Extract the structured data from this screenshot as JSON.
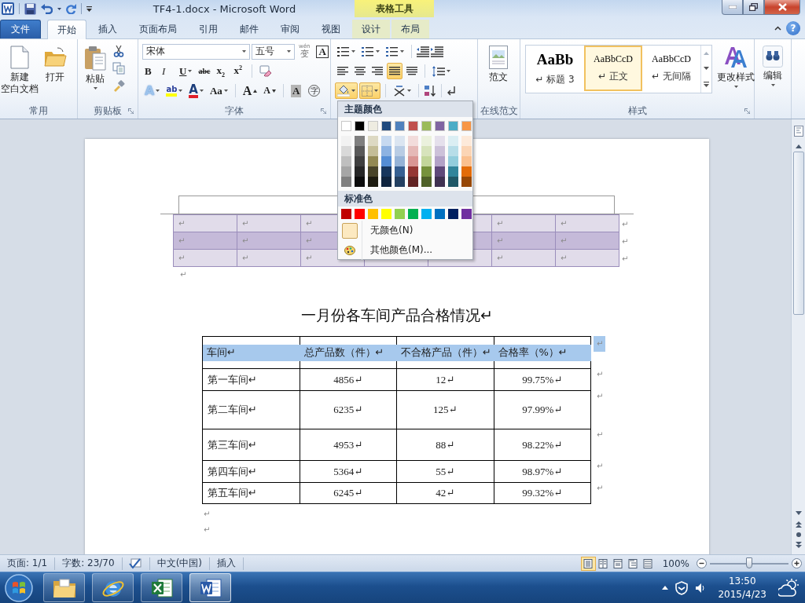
{
  "window": {
    "title": "TF4-1.docx  -  Microsoft Word",
    "context_group": "表格工具"
  },
  "tabs": [
    {
      "label": "文件",
      "kind": "file",
      "selected": false
    },
    {
      "label": "开始",
      "kind": "tab",
      "selected": true
    },
    {
      "label": "插入",
      "kind": "tab",
      "selected": false
    },
    {
      "label": "页面布局",
      "kind": "tab",
      "selected": false
    },
    {
      "label": "引用",
      "kind": "tab",
      "selected": false
    },
    {
      "label": "邮件",
      "kind": "tab",
      "selected": false
    },
    {
      "label": "审阅",
      "kind": "tab",
      "selected": false
    },
    {
      "label": "视图",
      "kind": "tab",
      "selected": false
    },
    {
      "label": "设计",
      "kind": "context",
      "selected": false
    },
    {
      "label": "布局",
      "kind": "context",
      "selected": false
    }
  ],
  "help": "?",
  "ribbon": {
    "common": {
      "label": "常用",
      "new_lines": [
        "新建",
        "空白文档"
      ],
      "open": "打开"
    },
    "clipboard": {
      "label": "剪贴板",
      "paste": "粘贴"
    },
    "font": {
      "label": "字体",
      "font_name": "宋体",
      "font_size": "五号",
      "phonetic": [
        "wén",
        "变"
      ],
      "char_border": "A",
      "row2": [
        [
          {
            "kind": "bold",
            "label": "B",
            "menu": false
          },
          {
            "kind": "italic",
            "label": "I",
            "menu": false
          },
          {
            "kind": "underline",
            "label": "U",
            "menu": true
          },
          {
            "kind": "strike",
            "label": "abc",
            "menu": false
          },
          {
            "kind": "script",
            "label": "x$_{2}$",
            "menu": false
          },
          {
            "kind": "script",
            "label": "x$^{2}$",
            "menu": false
          }
        ],
        [
          {
            "kind": "clear",
            "menu": false
          }
        ]
      ],
      "row3": [
        [
          {
            "kind": "effect",
            "label": "A",
            "menu": true
          },
          {
            "kind": "highlight",
            "label": "ab",
            "menu": true
          },
          {
            "kind": "color",
            "label": "A",
            "menu": true
          },
          {
            "kind": "case",
            "label": "Aa",
            "menu": true
          }
        ],
        [
          {
            "kind": "grow",
            "label": "A",
            "menu": false
          },
          {
            "kind": "shrink",
            "label": "A",
            "menu": false
          }
        ],
        [
          {
            "kind": "shade",
            "label": "A",
            "menu": false
          },
          {
            "kind": "enclose",
            "label": "字",
            "menu": false
          }
        ]
      ]
    },
    "paragraph": {
      "alignments": [
        {
          "kind": "left",
          "selected": false
        },
        {
          "kind": "center",
          "selected": false
        },
        {
          "kind": "right",
          "selected": false
        },
        {
          "kind": "justify",
          "selected": true
        },
        {
          "kind": "distribute",
          "selected": false
        }
      ],
      "shading_pressed": true,
      "borders_pressed": true
    },
    "online": {
      "label": "在线范文",
      "button": "范文"
    },
    "styles": {
      "label": "样式",
      "items": [
        {
          "preview": "AaBb",
          "name": "↵ 标题 3",
          "kind": "heading",
          "selected": false
        },
        {
          "preview": "AaBbCcD",
          "name": "↵ 正文",
          "kind": "normal",
          "selected": true
        },
        {
          "preview": "AaBbCcD",
          "name": "↵ 无间隔",
          "kind": "normal",
          "selected": false
        }
      ],
      "change": "更改样式"
    },
    "editing": {
      "button": "编辑"
    }
  },
  "color_menu": {
    "theme_title": "主题颜色",
    "theme_colors": [
      {
        "color": "#ffffff",
        "shades": [
          {
            "color": "#f2f2f2"
          },
          {
            "color": "#d9d9d9"
          },
          {
            "color": "#bfbfbf"
          },
          {
            "color": "#a6a6a6"
          },
          {
            "color": "#808080"
          }
        ]
      },
      {
        "color": "#000000",
        "shades": [
          {
            "color": "#7f7f7f"
          },
          {
            "color": "#595959"
          },
          {
            "color": "#3f3f3f"
          },
          {
            "color": "#262626"
          },
          {
            "color": "#0c0c0c"
          }
        ]
      },
      {
        "color": "#eeece1",
        "shades": [
          {
            "color": "#ddd9c3"
          },
          {
            "color": "#c4bd97"
          },
          {
            "color": "#938953"
          },
          {
            "color": "#494429"
          },
          {
            "color": "#1d1b10"
          }
        ]
      },
      {
        "color": "#1f497d",
        "shades": [
          {
            "color": "#c6d9f0"
          },
          {
            "color": "#8db3e2"
          },
          {
            "color": "#548dd4"
          },
          {
            "color": "#17365d"
          },
          {
            "color": "#0f243e"
          }
        ]
      },
      {
        "color": "#4f81bd",
        "shades": [
          {
            "color": "#dbe5f1"
          },
          {
            "color": "#b8cce4"
          },
          {
            "color": "#95b3d7"
          },
          {
            "color": "#366092"
          },
          {
            "color": "#244061"
          }
        ]
      },
      {
        "color": "#c0504d",
        "shades": [
          {
            "color": "#f2dcdb"
          },
          {
            "color": "#e5b9b7"
          },
          {
            "color": "#d99694"
          },
          {
            "color": "#953734"
          },
          {
            "color": "#632423"
          }
        ]
      },
      {
        "color": "#9bbb59",
        "shades": [
          {
            "color": "#ebf1dd"
          },
          {
            "color": "#d7e3bc"
          },
          {
            "color": "#c3d69b"
          },
          {
            "color": "#76923c"
          },
          {
            "color": "#4f6128"
          }
        ]
      },
      {
        "color": "#8064a2",
        "shades": [
          {
            "color": "#e5e0ec"
          },
          {
            "color": "#ccc1d9"
          },
          {
            "color": "#b2a2c7"
          },
          {
            "color": "#5f497a"
          },
          {
            "color": "#3f3151"
          }
        ]
      },
      {
        "color": "#4bacc6",
        "shades": [
          {
            "color": "#dbeef3"
          },
          {
            "color": "#b7dde8"
          },
          {
            "color": "#92cddc"
          },
          {
            "color": "#31859b"
          },
          {
            "color": "#205867"
          }
        ]
      },
      {
        "color": "#f79646",
        "shades": [
          {
            "color": "#fdeada"
          },
          {
            "color": "#fbd5b5"
          },
          {
            "color": "#fac08f"
          },
          {
            "color": "#e36c09"
          },
          {
            "color": "#974806"
          }
        ]
      }
    ],
    "standard_title": "标准色",
    "standard_colors": [
      {
        "color": "#c00000"
      },
      {
        "color": "#ff0000"
      },
      {
        "color": "#ffc000"
      },
      {
        "color": "#ffff00"
      },
      {
        "color": "#92d050"
      },
      {
        "color": "#00b050"
      },
      {
        "color": "#00b0f0"
      },
      {
        "color": "#0070c0"
      },
      {
        "color": "#002060"
      },
      {
        "color": "#7030a0"
      }
    ],
    "no_color": "无颜色(N)",
    "more_colors": "其他颜色(M)..."
  },
  "document": {
    "banded_table": {
      "rows": [
        {
          "color": "#e1dcea",
          "cells": [
            "↵",
            "↵",
            "↵",
            null,
            null,
            "↵",
            "↵"
          ],
          "end": "↵"
        },
        {
          "color": "#c5bad9",
          "cells": [
            "↵",
            "↵",
            "↵",
            null,
            null,
            "↵",
            "↵"
          ],
          "end": "↵"
        },
        {
          "color": "#e1dcea",
          "cells": [
            "↵",
            "↵",
            "↵",
            null,
            null,
            "↵",
            "↵"
          ],
          "end": "↵"
        }
      ]
    },
    "after_mark": "↵",
    "title": "一月份各车间产品合格情况↵",
    "table": {
      "header_selected": true,
      "columns": [
        "车间↵",
        "总产品数（件）↵",
        "不合格产品（件）↵",
        "合格率（%）↵"
      ],
      "header_end": "↵",
      "rows": [
        {
          "cells": [
            "第一车间↵",
            "4856↵",
            "12↵",
            "99.75%↵"
          ],
          "end": "↵"
        },
        {
          "cells": [
            "第二车间↵",
            "6235↵",
            "125↵",
            "97.99%↵"
          ],
          "end": "↵"
        },
        {
          "cells": [
            "第三车间↵",
            "4953↵",
            "88↵",
            "98.22%↵"
          ],
          "end": "↵"
        },
        {
          "cells": [
            "第四车间↵",
            "5364↵",
            "55↵",
            "98.97%↵"
          ],
          "end": "↵"
        },
        {
          "cells": [
            "第五车间↵",
            "6245↵",
            "42↵",
            "99.32%↵"
          ],
          "end": "↵"
        }
      ]
    },
    "trailing_marks": [
      "↵",
      "↵"
    ]
  },
  "status_bar": {
    "page": "页面: 1/1",
    "words": "字数: 23/70",
    "language": "中文(中国)",
    "mode": "插入",
    "views": [
      {
        "selected": true
      },
      {
        "selected": false
      },
      {
        "selected": false
      },
      {
        "selected": false
      },
      {
        "selected": false
      }
    ],
    "zoom": "100%",
    "zoom_slider": {
      "level": 0.5
    }
  },
  "taskbar": {
    "apps": [
      {
        "kind": "explorer",
        "selected": false
      },
      {
        "kind": "browser",
        "selected": false
      },
      {
        "kind": "excel",
        "selected": false
      },
      {
        "kind": "word",
        "selected": true
      }
    ],
    "time": "13:50",
    "date": "2015/4/23"
  }
}
